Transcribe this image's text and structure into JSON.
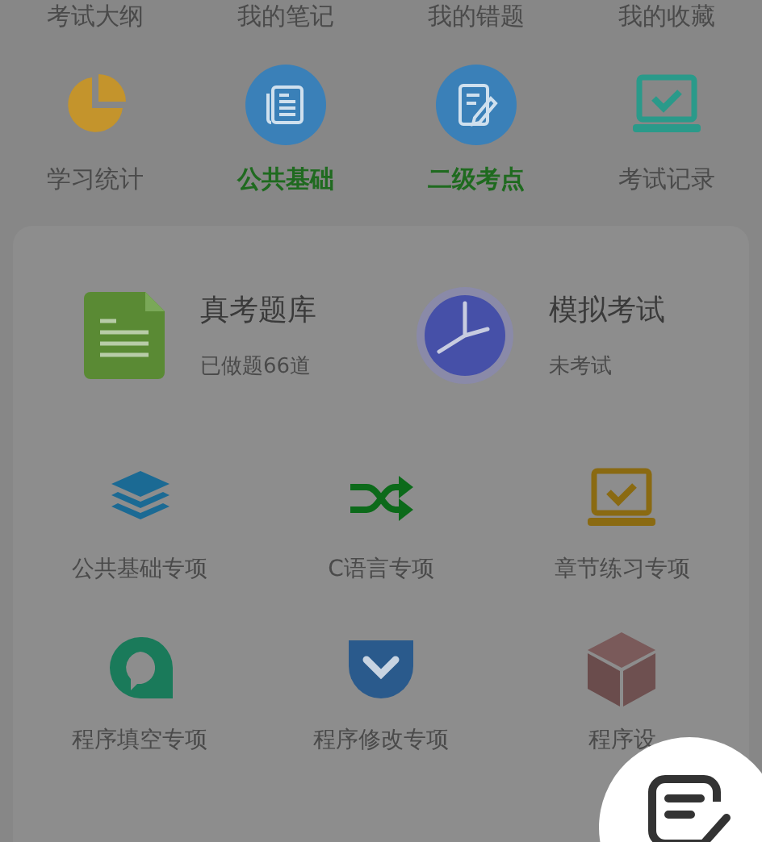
{
  "top_links": [
    {
      "label": "考试大纲"
    },
    {
      "label": "我的笔记"
    },
    {
      "label": "我的错题"
    },
    {
      "label": "我的收藏"
    }
  ],
  "tools": [
    {
      "label": "学习统计",
      "kind": "pie",
      "highlight": false
    },
    {
      "label": "公共基础",
      "kind": "news",
      "highlight": true
    },
    {
      "label": "二级考点",
      "kind": "edit",
      "highlight": true
    },
    {
      "label": "考试记录",
      "kind": "laptop",
      "highlight": false
    }
  ],
  "featured": [
    {
      "title": "真考题库",
      "subtitle": "已做题66道",
      "kind": "document"
    },
    {
      "title": "模拟考试",
      "subtitle": "未考试",
      "kind": "clock"
    }
  ],
  "practice": [
    {
      "label": "公共基础专项",
      "kind": "layers"
    },
    {
      "label": "C语言专项",
      "kind": "shuffle"
    },
    {
      "label": "章节练习专项",
      "kind": "laptop"
    },
    {
      "label": "程序填空专项",
      "kind": "speech"
    },
    {
      "label": "程序修改专项",
      "kind": "pocket"
    },
    {
      "label": "程序设",
      "kind": "cube"
    }
  ]
}
